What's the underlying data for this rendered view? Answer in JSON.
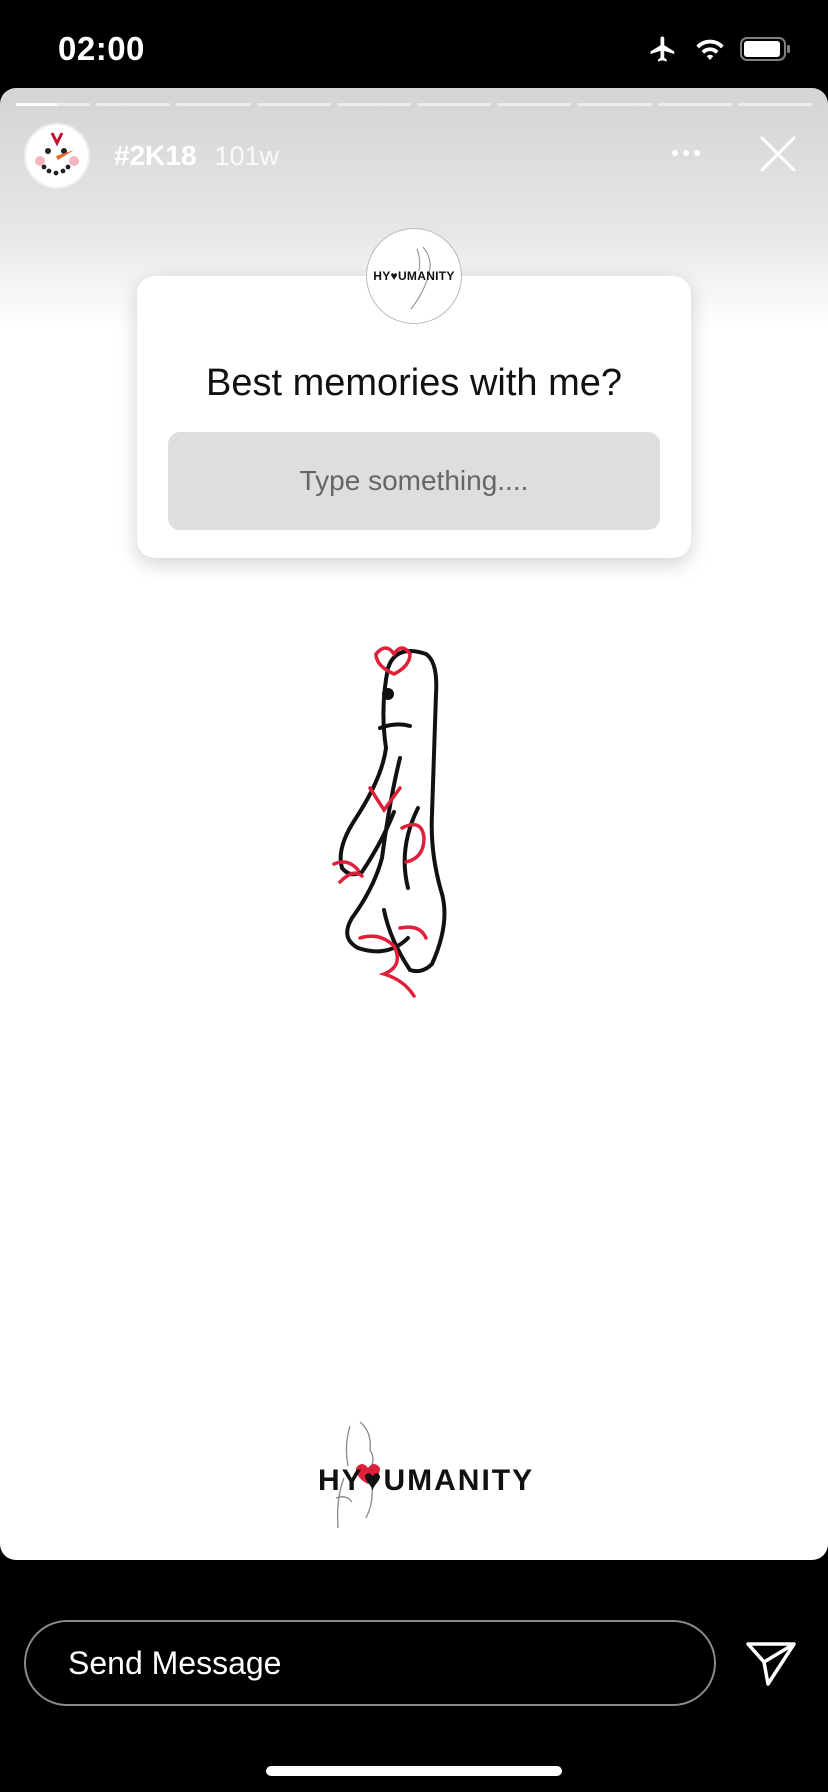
{
  "status_bar": {
    "time": "02:00",
    "icons": [
      "airplane-icon",
      "wifi-icon",
      "battery-icon"
    ]
  },
  "story": {
    "progress": {
      "segments": 10,
      "current_index": 0,
      "current_fill": 0.55
    },
    "header": {
      "username": "#2K18",
      "time_ago": "101w"
    },
    "question_sticker": {
      "avatar_text": "HY♥UMANITY",
      "question": "Best memories with me?",
      "placeholder": "Type something...."
    },
    "brand": {
      "text": "HY♥UMANITY"
    }
  },
  "footer": {
    "send_placeholder": "Send Message"
  },
  "colors": {
    "background": "#000000",
    "accent": "#e0203a",
    "input_bg": "#dedede"
  }
}
